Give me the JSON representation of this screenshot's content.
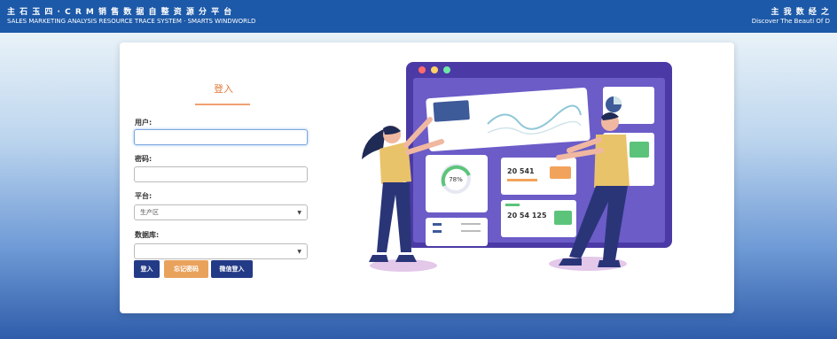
{
  "header": {
    "title_cn": "主 石 玉 四 · C R M 销 售 数 据 自 整 资 源 分 平 台",
    "title_en": "SALES MARKETING ANALYSIS RESOURCE TRACE SYSTEM · SMARTS WINDWORLD",
    "right_cn": "主 我 数 经 之",
    "right_en": "Discover The Beauti Of D"
  },
  "login": {
    "title": "登入",
    "user_label": "用户:",
    "user_value": "",
    "password_label": "密码:",
    "password_value": "",
    "platform_label": "平台:",
    "platform_selected": "生产区",
    "database_label": "数据库:",
    "database_selected": "",
    "buttons": {
      "login": "登入",
      "reset": "忘记密码",
      "demo": "微信登入"
    }
  },
  "illustration": {
    "stat1": "20 541",
    "stat2": "20 54 125",
    "gauge": "78%"
  },
  "colors": {
    "header_bg": "#1c59a8",
    "accent_orange": "#e07a3a",
    "button_dark": "#233a86",
    "button_orange": "#e9a25c"
  }
}
